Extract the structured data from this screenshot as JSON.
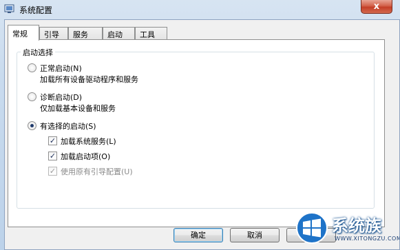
{
  "window": {
    "title": "系统配置",
    "close_symbol": "x"
  },
  "tabs": [
    {
      "label": "常规",
      "active": true
    },
    {
      "label": "引导",
      "active": false
    },
    {
      "label": "服务",
      "active": false
    },
    {
      "label": "启动",
      "active": false
    },
    {
      "label": "工具",
      "active": false
    }
  ],
  "startup": {
    "group_label": "启动选择",
    "normal": {
      "label": "正常启动(N)",
      "description": "加载所有设备驱动程序和服务",
      "checked": false
    },
    "diagnostic": {
      "label": "诊断启动(D)",
      "description": "仅加载基本设备和服务",
      "checked": false
    },
    "selective": {
      "label": "有选择的启动(S)",
      "checked": true,
      "options": [
        {
          "label": "加载系统服务(L)",
          "checked": true,
          "enabled": true
        },
        {
          "label": "加载启动项(O)",
          "checked": true,
          "enabled": true
        },
        {
          "label": "使用原有引导配置(U)",
          "checked": true,
          "enabled": false
        }
      ]
    }
  },
  "buttons": {
    "ok": "确定",
    "cancel": "取消",
    "apply": "应"
  },
  "watermark": {
    "brand": "系统族",
    "url": "WWW.XITONGZU.COM"
  },
  "colors": {
    "close": "#c43e27",
    "default_button_border": "#3c7fb1",
    "tab_border": "#8e8f8f"
  }
}
